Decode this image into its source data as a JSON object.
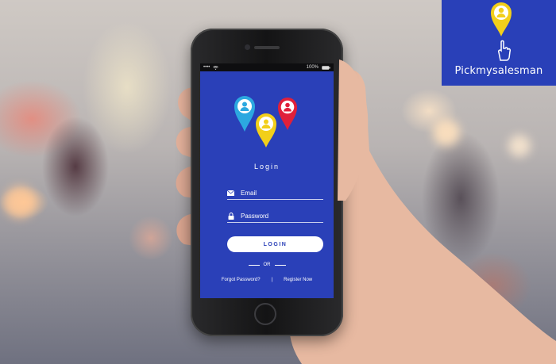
{
  "brand": {
    "name": "Pickmysalesman",
    "color": "#2940b8"
  },
  "statusbar": {
    "signal": "••••",
    "battery_text": "100%"
  },
  "login": {
    "title": "Login",
    "email_placeholder": "Email",
    "password_placeholder": "Password",
    "login_button": "LOGIN",
    "or_text": "OR",
    "forgot_link": "Forgot Password?",
    "separator": "|",
    "register_link": "Register Now"
  },
  "colors": {
    "screen_bg": "#2a40b8",
    "pin_blue": "#2ca8e0",
    "pin_red": "#e0203a",
    "pin_yellow": "#f2cf1a"
  },
  "icons": [
    "map-pin-icon",
    "hand-pointer-icon",
    "envelope-icon",
    "lock-icon",
    "wifi-icon",
    "battery-icon",
    "user-icon"
  ]
}
